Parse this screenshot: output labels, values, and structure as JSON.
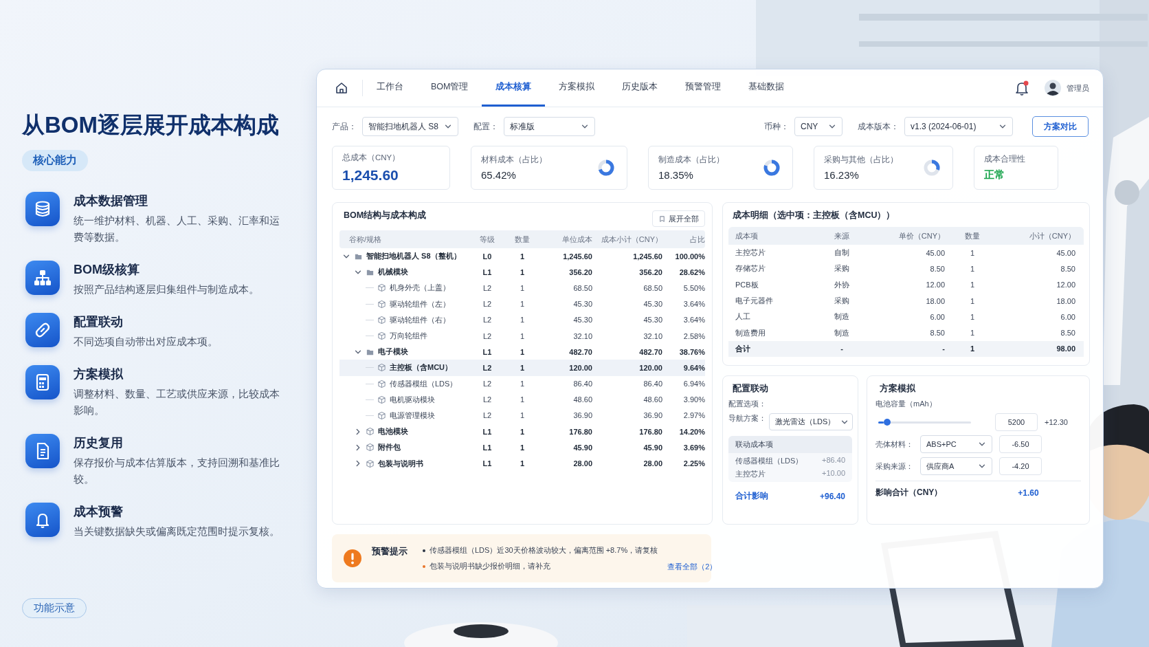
{
  "slide": {
    "title": "从BOM逐层展开成本构成",
    "tag": "核心能力",
    "features": [
      {
        "title": "成本数据管理",
        "text": "统一维护材料、机器、人工、采购、汇率和运费等数据。"
      },
      {
        "title": "BOM级核算",
        "text": "按照产品结构逐层归集组件与制造成本。"
      },
      {
        "title": "配置联动",
        "text": "不同选项自动带出对应成本项。"
      },
      {
        "title": "方案模拟",
        "text": "调整材料、数量、工艺或供应来源，比较成本影响。"
      },
      {
        "title": "历史复用",
        "text": "保存报价与成本估算版本，支持回溯和基准比较。"
      },
      {
        "title": "成本预警",
        "text": "当关键数据缺失或偏离既定范围时提示复核。"
      }
    ],
    "footer_tag": "功能示意"
  },
  "app": {
    "tabs": [
      {
        "label": "工作台",
        "selected": false
      },
      {
        "label": "BOM管理",
        "selected": false
      },
      {
        "label": "成本核算",
        "selected": true
      },
      {
        "label": "方案模拟",
        "selected": false
      },
      {
        "label": "历史版本",
        "selected": false
      },
      {
        "label": "预警管理",
        "selected": false
      },
      {
        "label": "基础数据",
        "selected": false
      }
    ],
    "user": "管理员",
    "left_filters": [
      {
        "label": "产品：",
        "value": "智能扫地机器人 S8"
      },
      {
        "label": "配置：",
        "value": "标准版"
      }
    ],
    "right_filters": [
      {
        "label": "币种：",
        "value": "CNY"
      },
      {
        "label": "成本版本：",
        "value": "v1.3 (2024-06-01)"
      }
    ],
    "compare_button": "方案对比",
    "kpis": [
      {
        "kind": "total",
        "label": "总成本（CNY）",
        "value": "1,245.60"
      },
      {
        "kind": "ratio",
        "label": "材料成本（占比）",
        "value": "65.42%",
        "level": 0.7
      },
      {
        "kind": "ratio",
        "label": "制造成本（占比）",
        "value": "18.35%",
        "level": 0.8
      },
      {
        "kind": "ratio",
        "label": "采购与其他（占比）",
        "value": "16.23%",
        "level": 0.3
      },
      {
        "kind": "status",
        "label": "成本合理性",
        "value": "正常"
      }
    ],
    "bom": {
      "title": "BOM结构与成本构成",
      "expand_button": "展开全部",
      "columns": [
        "谷称/规格",
        "等级",
        "数量",
        "单位成本",
        "成本小计（CNY）",
        "占比"
      ],
      "rows": [
        {
          "name": "智能扫地机器人 S8（整机）",
          "level": "L0",
          "qty": "1",
          "unit": "1,245.60",
          "subtotal": "1,245.60",
          "share": "100.00%",
          "expanded": true,
          "selected": false,
          "children": [
            {
              "name": "机械模块",
              "level": "L1",
              "qty": "1",
              "unit": "356.20",
              "subtotal": "356.20",
              "share": "28.62%",
              "expanded": true,
              "selected": false,
              "children": [
                {
                  "name": "机身外壳（上盖）",
                  "level": "L2",
                  "qty": "1",
                  "unit": "68.50",
                  "subtotal": "68.50",
                  "share": "5.50%",
                  "selected": false
                },
                {
                  "name": "驱动轮组件（左）",
                  "level": "L2",
                  "qty": "1",
                  "unit": "45.30",
                  "subtotal": "45.30",
                  "share": "3.64%",
                  "selected": false
                },
                {
                  "name": "驱动轮组件（右）",
                  "level": "L2",
                  "qty": "1",
                  "unit": "45.30",
                  "subtotal": "45.30",
                  "share": "3.64%",
                  "selected": false
                },
                {
                  "name": "万向轮组件",
                  "level": "L2",
                  "qty": "1",
                  "unit": "32.10",
                  "subtotal": "32.10",
                  "share": "2.58%",
                  "selected": false
                }
              ]
            },
            {
              "name": "电子模块",
              "level": "L1",
              "qty": "1",
              "unit": "482.70",
              "subtotal": "482.70",
              "share": "38.76%",
              "expanded": true,
              "selected": false,
              "children": [
                {
                  "name": "主控板（含MCU）",
                  "level": "L2",
                  "qty": "1",
                  "unit": "120.00",
                  "subtotal": "120.00",
                  "share": "9.64%",
                  "selected": true
                },
                {
                  "name": "传感器模组（LDS）",
                  "level": "L2",
                  "qty": "1",
                  "unit": "86.40",
                  "subtotal": "86.40",
                  "share": "6.94%",
                  "selected": false
                },
                {
                  "name": "电机驱动模块",
                  "level": "L2",
                  "qty": "1",
                  "unit": "48.60",
                  "subtotal": "48.60",
                  "share": "3.90%",
                  "selected": false
                },
                {
                  "name": "电源管理模块",
                  "level": "L2",
                  "qty": "1",
                  "unit": "36.90",
                  "subtotal": "36.90",
                  "share": "2.97%",
                  "selected": false
                }
              ]
            },
            {
              "name": "电池模块",
              "level": "L1",
              "qty": "1",
              "unit": "176.80",
              "subtotal": "176.80",
              "share": "14.20%",
              "expanded": false,
              "selected": false
            },
            {
              "name": "附件包",
              "level": "L1",
              "qty": "1",
              "unit": "45.90",
              "subtotal": "45.90",
              "share": "3.69%",
              "expanded": false,
              "selected": false
            },
            {
              "name": "包装与说明书",
              "level": "L1",
              "qty": "1",
              "unit": "28.00",
              "subtotal": "28.00",
              "share": "2.25%",
              "expanded": false,
              "selected": false
            }
          ]
        }
      ]
    },
    "detail": {
      "title": "成本明细（选中项：主控板（含MCU））",
      "columns": [
        "成本项",
        "来源",
        "单价（CNY）",
        "数量",
        "小计（CNY）"
      ],
      "rows": [
        {
          "kind": "item",
          "item": "主控芯片",
          "source": "自制",
          "price": "45.00",
          "qty": "1",
          "subtotal": "45.00"
        },
        {
          "kind": "item",
          "item": "存储芯片",
          "source": "采购",
          "price": "8.50",
          "qty": "1",
          "subtotal": "8.50"
        },
        {
          "kind": "item",
          "item": "PCB板",
          "source": "外协",
          "price": "12.00",
          "qty": "1",
          "subtotal": "12.00"
        },
        {
          "kind": "item",
          "item": "电子元器件",
          "source": "采购",
          "price": "18.00",
          "qty": "1",
          "subtotal": "18.00"
        },
        {
          "kind": "item",
          "item": "人工",
          "source": "制造",
          "price": "6.00",
          "qty": "1",
          "subtotal": "6.00"
        },
        {
          "kind": "item",
          "item": "制造费用",
          "source": "制造",
          "price": "8.50",
          "qty": "1",
          "subtotal": "8.50"
        },
        {
          "kind": "total",
          "item": "合计",
          "source": "-",
          "price": "-",
          "qty": "1",
          "subtotal": "98.00"
        }
      ]
    },
    "config": {
      "title": "配置联动",
      "options_label": "配置选项：",
      "field_label": "导航方案：",
      "field_value": "激光雷达（LDS）",
      "linked_title": "联动成本项",
      "linked": [
        {
          "name": "传感器模组（LDS）",
          "delta": "+86.40"
        },
        {
          "name": "主控芯片",
          "delta": "+10.00"
        }
      ],
      "total_label": "合计影响",
      "total_value": "+96.40"
    },
    "simulation": {
      "title": "方案模拟",
      "slider_label": "电池容量（mAh）",
      "slider": {
        "level": 0.06
      },
      "slider_value": "5200",
      "slider_delta": "+12.30",
      "rows": [
        {
          "label": "壳体材料：",
          "value": "ABS+PC",
          "delta": "-6.50"
        },
        {
          "label": "采购来源：",
          "value": "供应商A",
          "delta": "-4.20"
        }
      ],
      "total_label": "影响合计（CNY）",
      "total_value": "+1.60"
    },
    "alert": {
      "title": "预警提示",
      "items": [
        {
          "text": "传感器模组（LDS）近30天价格波动较大，偏离范围 +8.7%，请复核",
          "color": "#2b3445"
        },
        {
          "text": "包装与说明书缺少报价明细，请补充",
          "color": "#e8742a"
        }
      ],
      "link": "查看全部（2）"
    }
  }
}
